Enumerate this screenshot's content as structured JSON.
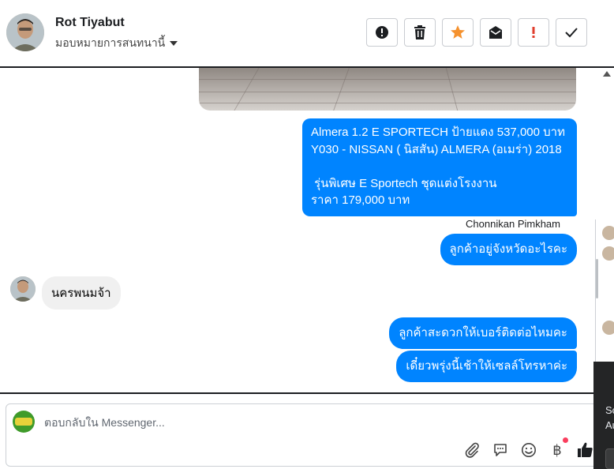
{
  "header": {
    "contact_name": "Rot Tiyabut",
    "assign_label": "มอบหมายการสนทนานี้",
    "toolbar": [
      {
        "icon": "alert-circle-icon",
        "tooltip": ""
      },
      {
        "icon": "trash-icon",
        "tooltip": ""
      },
      {
        "icon": "star-icon",
        "color": "#f5922f"
      },
      {
        "icon": "mark-unread-icon"
      },
      {
        "icon": "priority-exclamation-icon",
        "color": "#e03e2d"
      },
      {
        "icon": "check-icon"
      }
    ]
  },
  "thread": {
    "messages": [
      {
        "direction": "outgoing",
        "text": "Almera 1.2 E SPORTECH ป้ายแดง 537,000 บาท\nY030 - NISSAN ( นิสสัน) ALMERA (อเมร่า) 2018\n\n รุ่นพิเศษ E Sportech ชุดแต่งโรงงาน\nราคา 179,000 บาท"
      },
      {
        "direction": "outgoing",
        "sender": "Chonnikan Pimkham",
        "text": "ลูกค้าอยู่จังหวัดอะไรคะ"
      },
      {
        "direction": "incoming",
        "text": "นครพนมจ้า"
      },
      {
        "direction": "outgoing",
        "text": "ลูกค้าสะดวกให้เบอร์ติดต่อไหมคะ"
      },
      {
        "direction": "outgoing",
        "text": "เดี๋ยวพรุ่งนี้เช้าให้เซลล์โทรหาค่ะ"
      }
    ],
    "bubble_color": "#0084ff",
    "incoming_bubble_color": "#f0f0f0"
  },
  "composer": {
    "placeholder": "ตอบกลับใน Messenger...",
    "icons": [
      "attach-icon",
      "saved-reply-icon",
      "emoji-icon",
      "payment-icon",
      "like-icon"
    ],
    "payment_glyph": "฿"
  },
  "side_panel": {
    "text_line1": "So",
    "text_line2": "Au"
  }
}
